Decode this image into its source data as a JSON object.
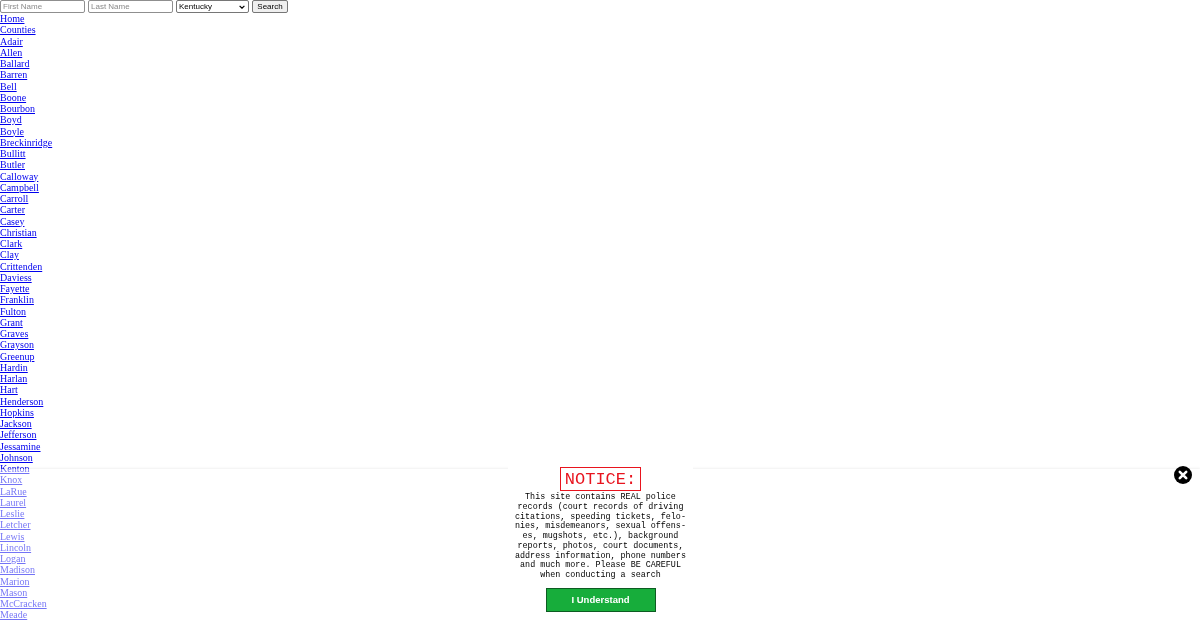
{
  "search_form": {
    "first_name": {
      "placeholder": "First Name"
    },
    "last_name": {
      "placeholder": "Last Name"
    },
    "state": {
      "value": "Kentucky"
    },
    "button": "Search"
  },
  "nav_links": [
    "Home",
    "Counties",
    "Adair",
    "Allen",
    "Ballard",
    "Barren",
    "Bell",
    "Boone",
    "Bourbon",
    "Boyd",
    "Boyle",
    "Breckinridge",
    "Bullitt",
    "Butler",
    "Calloway",
    "Campbell",
    "Carroll",
    "Carter",
    "Casey",
    "Christian",
    "Clark",
    "Clay",
    "Crittenden",
    "Daviess",
    "Fayette",
    "Franklin",
    "Fulton",
    "Grant",
    "Graves",
    "Grayson",
    "Greenup",
    "Hardin",
    "Harlan",
    "Hart",
    "Henderson",
    "Hopkins",
    "Jackson",
    "Jefferson",
    "Jessamine",
    "Johnson",
    "Kenton",
    "Knox",
    "LaRue",
    "Laurel",
    "Leslie",
    "Letcher",
    "Lewis",
    "Lincoln",
    "Logan",
    "Madison",
    "Marion",
    "Mason",
    "McCracken",
    "Meade"
  ],
  "notice": {
    "title": "NOTICE:",
    "lines": [
      "This site contains REAL police",
      "records (court records of driving",
      "citations, speeding tickets, felo-",
      "nies, misdemeanors, sexual offens-",
      "es, mugshots, etc.), background",
      "reports, photos, court documents,",
      "address information, phone numbers",
      "and much more. Please BE CAREFUL",
      "when conducting a search"
    ],
    "button": "I Understand"
  }
}
